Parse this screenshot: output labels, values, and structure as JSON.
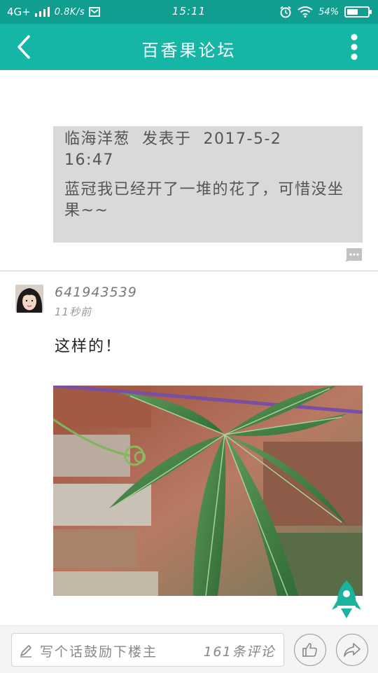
{
  "status_bar": {
    "network": "4G+",
    "speed": "0.8K/s",
    "time": "15:11",
    "battery": "54%",
    "battery_level": 0.54
  },
  "app_bar": {
    "title": "百香果论坛"
  },
  "quote": {
    "author": "临海洋葱",
    "posted_label": "发表于",
    "date": "2017-5-2",
    "time": "16:47",
    "text": "蓝冠我已经开了一堆的花了，可惜没坐果~~"
  },
  "reply": {
    "username": "641943539",
    "time_ago": "11秒前",
    "text": "这样的！"
  },
  "bottom_bar": {
    "input_placeholder": "写个话鼓励下楼主",
    "comment_count": "161条评论"
  },
  "colors": {
    "status_bar": "#0f9e90",
    "app_bar": "#16b6a6",
    "rocket": "#1ab49e",
    "quote_bg": "#d9d9d9"
  },
  "icons": [
    "back-icon",
    "more-icon",
    "comment-icon",
    "pen-icon",
    "thumbs-up-icon",
    "share-icon",
    "rocket-icon",
    "alarm-icon",
    "wifi-icon",
    "signal-icon",
    "mail-icon"
  ]
}
